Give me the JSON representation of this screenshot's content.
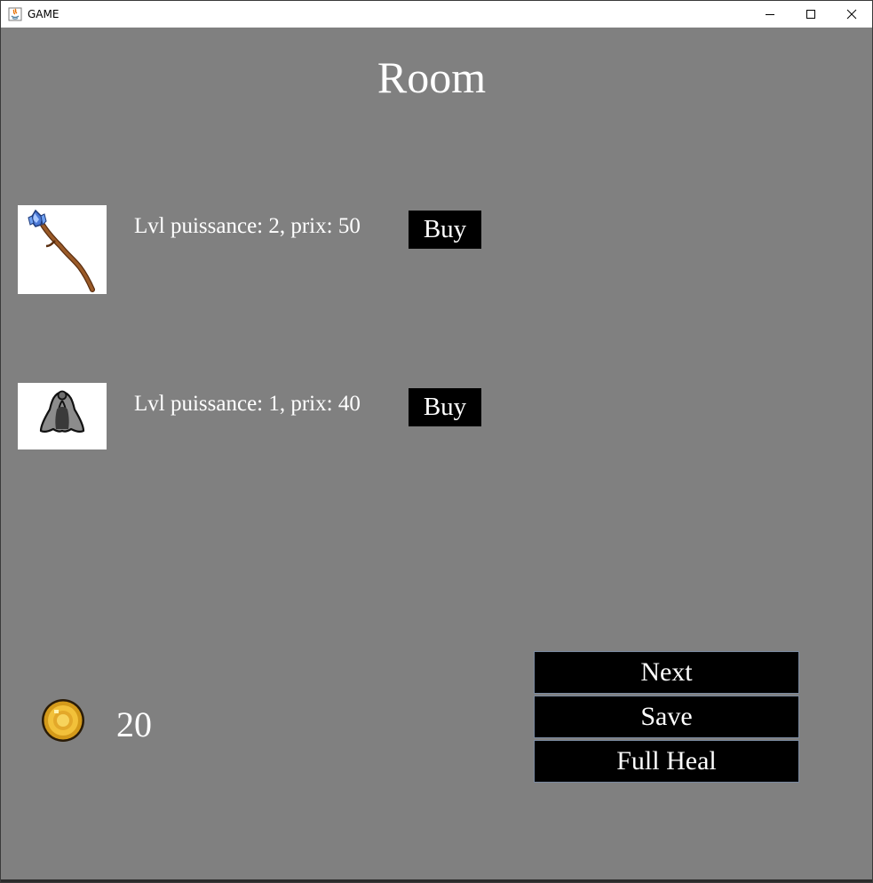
{
  "window": {
    "title": "GAME"
  },
  "screen": {
    "title": "Room"
  },
  "shop": {
    "items": [
      {
        "icon": "crystal-staff-icon",
        "description": "Lvl puissance: 2, prix: 50",
        "buy_label": "Buy"
      },
      {
        "icon": "cloak-icon",
        "description": "Lvl puissance: 1, prix: 40",
        "buy_label": "Buy"
      }
    ]
  },
  "player": {
    "gold_icon": "gold-coin-icon",
    "gold": "20"
  },
  "menu": {
    "next_label": "Next",
    "save_label": "Save",
    "full_heal_label": "Full Heal"
  },
  "colors": {
    "background": "#808080",
    "button": "#000000",
    "text": "#ffffff",
    "button_border": "#7a8aa0"
  }
}
